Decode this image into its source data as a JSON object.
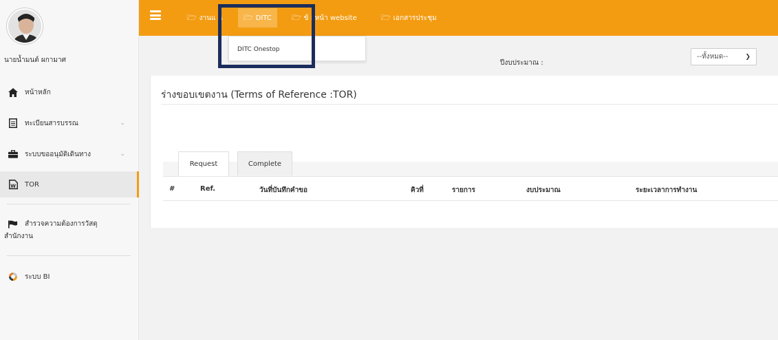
{
  "user": {
    "name": "นายน้ำมนต์ ผกามาศ"
  },
  "sidebar": {
    "items": [
      {
        "label": "หน้าหลัก"
      },
      {
        "label": "ทะเบียนสารบรรณ"
      },
      {
        "label": "ระบบขออนุมัติเดินทาง"
      },
      {
        "label": "TOR"
      },
      {
        "label_line1": "สำรวจความต้องการวัสดุ",
        "label_line2": "สำนักงาน"
      },
      {
        "label": "ระบบ BI"
      }
    ]
  },
  "topbar": {
    "menus": [
      {
        "label": "งานแ    น"
      },
      {
        "label": "DITC"
      },
      {
        "label": "ข้    ลหน้า website"
      },
      {
        "label": "เอกสารประชุม"
      }
    ],
    "dropdown_item": "DITC Onestop"
  },
  "filter": {
    "label": "ปีงบประมาณ :",
    "selected": "--ทั้งหมด--"
  },
  "main": {
    "title": "ร่างขอบเขตงาน (Terms of Reference :TOR)",
    "tabs": [
      {
        "label": "Request"
      },
      {
        "label": "Complete"
      }
    ],
    "columns": [
      "#",
      "Ref.",
      "วันที่บันทึกคำขอ",
      "คิวที่",
      "รายการ",
      "งบประมาณ",
      "ระยะเวลาการทำงาน"
    ]
  },
  "colors": {
    "accent": "#f39c12",
    "highlight_border": "#1b2d5c"
  }
}
